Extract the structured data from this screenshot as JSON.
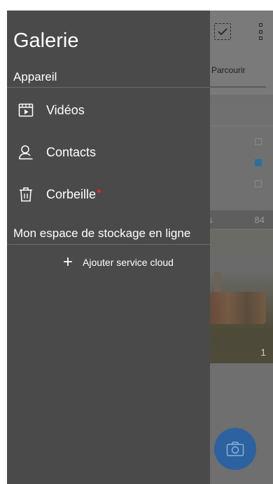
{
  "drawer": {
    "title": "Galerie",
    "device_section": "Appareil",
    "items": [
      {
        "label": "Vidéos",
        "icon": "video-icon"
      },
      {
        "label": "Contacts",
        "icon": "person-icon"
      },
      {
        "label": "Corbeille",
        "icon": "trash-icon",
        "badge": true
      }
    ],
    "cloud_section": "Mon espace de stockage en ligne",
    "add_cloud_label": "Ajouter service cloud"
  },
  "background": {
    "tab_label": "Parcourir",
    "section_count": "84",
    "section_partial_label": "s",
    "photo_count": "1",
    "checkbox_states": [
      false,
      true,
      false
    ]
  },
  "colors": {
    "drawer_bg": "#4a4a4a",
    "badge": "#e5262a",
    "fab": "#2c62a0",
    "check_on": "#2b6fa0"
  }
}
